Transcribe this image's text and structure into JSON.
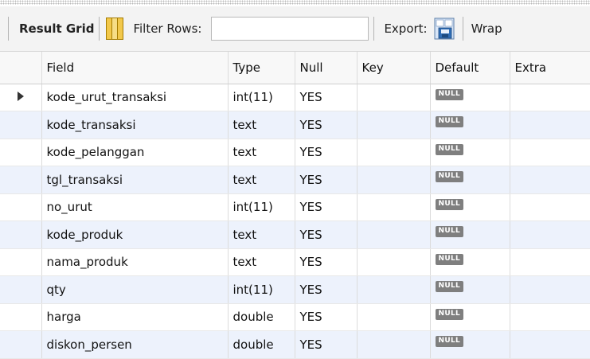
{
  "toolbar": {
    "result_grid_label": "Result Grid",
    "filter_label": "Filter Rows:",
    "filter_value": "",
    "export_label": "Export:",
    "wrap_label": "Wrap"
  },
  "icons": {
    "grid_icon": "result-grid-icon",
    "export_icon": "export-save-icon",
    "row_pointer": "current-row-arrow-icon"
  },
  "colors": {
    "toolbar_bg": "#f3f3f3",
    "alt_row_bg": "#edf2fc",
    "null_badge_bg": "#7f7f7f",
    "grid_icon_yellow": "#f2c84b",
    "export_icon_blue": "#2f6db5"
  },
  "table": {
    "columns": [
      "Field",
      "Type",
      "Null",
      "Key",
      "Default",
      "Extra"
    ],
    "rows": [
      {
        "field": "kode_urut_transaksi",
        "type": "int(11)",
        "null": "YES",
        "key": "",
        "default": "NULL",
        "extra": ""
      },
      {
        "field": "kode_transaksi",
        "type": "text",
        "null": "YES",
        "key": "",
        "default": "NULL",
        "extra": ""
      },
      {
        "field": "kode_pelanggan",
        "type": "text",
        "null": "YES",
        "key": "",
        "default": "NULL",
        "extra": ""
      },
      {
        "field": "tgl_transaksi",
        "type": "text",
        "null": "YES",
        "key": "",
        "default": "NULL",
        "extra": ""
      },
      {
        "field": "no_urut",
        "type": "int(11)",
        "null": "YES",
        "key": "",
        "default": "NULL",
        "extra": ""
      },
      {
        "field": "kode_produk",
        "type": "text",
        "null": "YES",
        "key": "",
        "default": "NULL",
        "extra": ""
      },
      {
        "field": "nama_produk",
        "type": "text",
        "null": "YES",
        "key": "",
        "default": "NULL",
        "extra": ""
      },
      {
        "field": "qty",
        "type": "int(11)",
        "null": "YES",
        "key": "",
        "default": "NULL",
        "extra": ""
      },
      {
        "field": "harga",
        "type": "double",
        "null": "YES",
        "key": "",
        "default": "NULL",
        "extra": ""
      },
      {
        "field": "diskon_persen",
        "type": "double",
        "null": "YES",
        "key": "",
        "default": "NULL",
        "extra": ""
      }
    ]
  }
}
